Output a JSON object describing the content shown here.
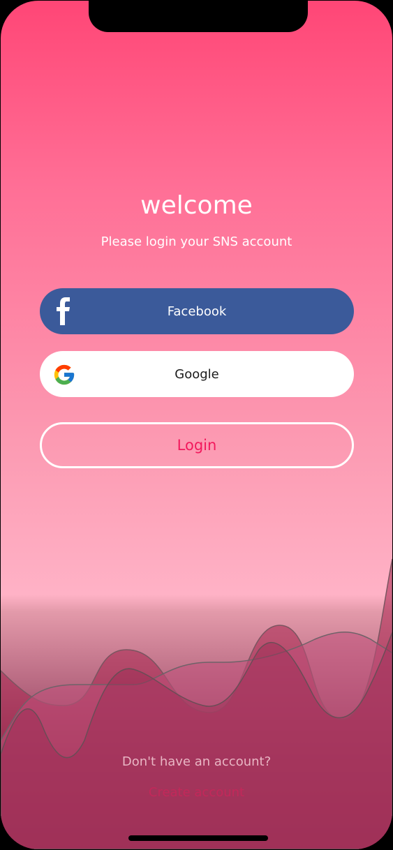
{
  "header": {
    "title": "welcome",
    "subtitle": "Please login your SNS account"
  },
  "buttons": {
    "facebook_label": "Facebook",
    "facebook_icon": "facebook-icon",
    "google_label": "Google",
    "google_icon": "google-icon",
    "login_label": "Login"
  },
  "footer": {
    "prompt": "Don't have an account?",
    "create_account": "Create account"
  },
  "colors": {
    "accent": "#f2195d",
    "facebook": "#3b5a9a",
    "gradient_top": "#ff4676",
    "gradient_bottom": "#5e0a22"
  }
}
